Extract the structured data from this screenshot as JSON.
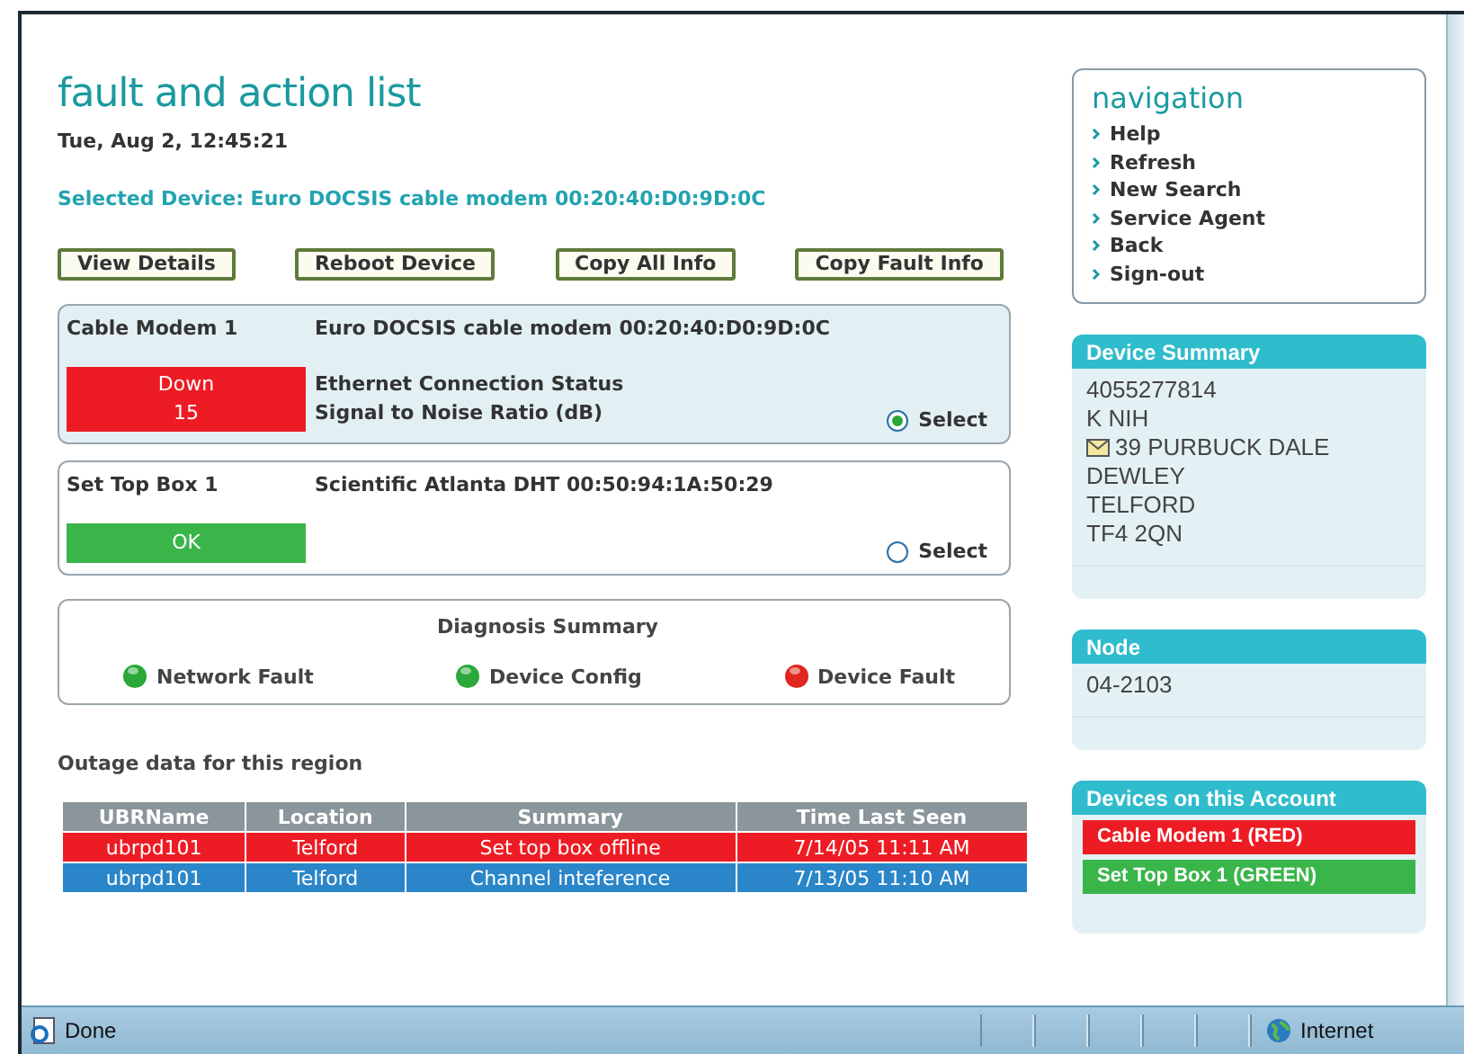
{
  "page": {
    "title": "fault and action list",
    "datetime": "Tue, Aug 2, 12:45:21",
    "selected_device": "Selected Device: Euro DOCSIS cable modem 00:20:40:D0:9D:0C"
  },
  "buttons": [
    "View Details",
    "Reboot Device",
    "Copy All Info",
    "Copy Fault Info"
  ],
  "devices": [
    {
      "name": "Cable Modem 1",
      "description": "Euro DOCSIS cable modem 00:20:40:D0:9D:0C",
      "status_lines": [
        "Down",
        "15"
      ],
      "color": "#ed1c24",
      "metrics": [
        "Ethernet Connection Status",
        "Signal to Noise Ratio (dB)"
      ],
      "select_label": "Select",
      "selected": true
    },
    {
      "name": "Set Top Box 1",
      "description": "Scientific Atlanta DHT 00:50:94:1A:50:29",
      "status_lines": [
        "OK"
      ],
      "color": "#3ab54a",
      "select_label": "Select",
      "selected": false
    }
  ],
  "diagnosis": {
    "title": "Diagnosis Summary",
    "items": [
      {
        "label": "Network Fault",
        "color": "#2aa83a"
      },
      {
        "label": "Device Config",
        "color": "#2aa83a"
      },
      {
        "label": "Device Fault",
        "color": "#e0261e"
      }
    ]
  },
  "outage": {
    "title": "Outage data for this region",
    "columns": [
      "UBRName",
      "Location",
      "Summary",
      "Time Last Seen"
    ],
    "rows": [
      {
        "cells": [
          "ubrpd101",
          "Telford",
          "Set top box offline",
          "7/14/05 11:11 AM"
        ],
        "color": "#ed1c24"
      },
      {
        "cells": [
          "ubrpd101",
          "Telford",
          "Channel inteference",
          "7/13/05 11:10 AM"
        ],
        "color": "#2a86c8"
      }
    ]
  },
  "navigation": {
    "title": "navigation",
    "items": [
      "Help",
      "Refresh",
      "New Search",
      "Service Agent",
      "Back",
      "Sign-out"
    ]
  },
  "device_summary": {
    "title": "Device Summary",
    "lines": [
      {
        "text": "4055277814"
      },
      {
        "text": "K NIH"
      },
      {
        "text": "39 PURBUCK DALE",
        "kind": "address"
      },
      {
        "text": "DEWLEY"
      },
      {
        "text": "TELFORD"
      },
      {
        "text": "TF4 2QN"
      }
    ]
  },
  "node": {
    "title": "Node",
    "value": "04-2103"
  },
  "account_devices": {
    "title": "Devices on this Account",
    "items": [
      {
        "label": "Cable Modem 1 (RED)",
        "color": "#ed1c24"
      },
      {
        "label": "Set Top Box 1 (GREEN)",
        "color": "#3ab54a"
      }
    ]
  },
  "status_bar": {
    "text": "Done",
    "zone": "Internet"
  }
}
